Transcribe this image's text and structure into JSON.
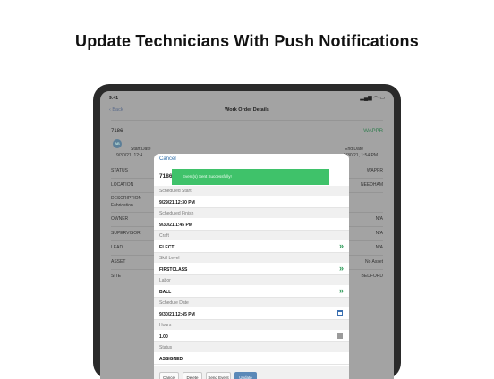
{
  "headline": "Update Technicians With Push Notifications",
  "status_bar": {
    "time": "9:41",
    "indicators": "▂▄▆ ◠ ▭"
  },
  "nav": {
    "back": "‹ Back",
    "title": "Work Order Details"
  },
  "background": {
    "wo_number": "7186",
    "wo_code": "WAPPR",
    "avatar": "AB",
    "start_label": "Start Date",
    "start_value": "9/30/21, 12:4",
    "end_label": "End Date",
    "end_value": "9/30/21, 1:54 PM",
    "rows": [
      {
        "label": "STATUS",
        "value": "WAPPR"
      },
      {
        "label": "LOCATION",
        "value": "NEEDHAM"
      },
      {
        "label": "DESCRIPTION",
        "value": ""
      },
      {
        "label": "Fabrication",
        "value": ""
      },
      {
        "label": "OWNER",
        "value": "N/A"
      },
      {
        "label": "SUPERVISOR",
        "value": "N/A"
      },
      {
        "label": "LEAD",
        "value": "N/A"
      },
      {
        "label": "ASSET",
        "value": "No Asset"
      },
      {
        "label": "SITE",
        "value": "BEDFORD"
      }
    ]
  },
  "modal": {
    "cancel_label": "Cancel",
    "wo_number": "7186",
    "toast": "Event(s) Sent Successfully!",
    "fields": [
      {
        "label": "Scheduled Start",
        "value": "9/29/21 12:30 PM",
        "control": "none"
      },
      {
        "label": "Scheduled Finish",
        "value": "9/30/21 1:45 PM",
        "control": "none"
      },
      {
        "label": "Craft",
        "value": "ELECT",
        "control": "chevron"
      },
      {
        "label": "Skill Level",
        "value": "FIRSTCLASS",
        "control": "chevron"
      },
      {
        "label": "Labor",
        "value": "BALL",
        "control": "chevron"
      },
      {
        "label": "Schedule Date",
        "value": "9/30/21 12:45 PM",
        "control": "calendar"
      },
      {
        "label": "Hours",
        "value": "1.00",
        "control": "keypad"
      },
      {
        "label": "Status",
        "value": "ASSIGNED",
        "control": "none"
      }
    ],
    "chevron_glyph": "»",
    "buttons": {
      "cancel": "Cancel",
      "delete": "Delete",
      "send_event": "Send Event",
      "update": "Update"
    }
  },
  "colors": {
    "toast": "#3fc26a",
    "accent": "#2e9a58",
    "primary_button": "#5b89b8"
  }
}
